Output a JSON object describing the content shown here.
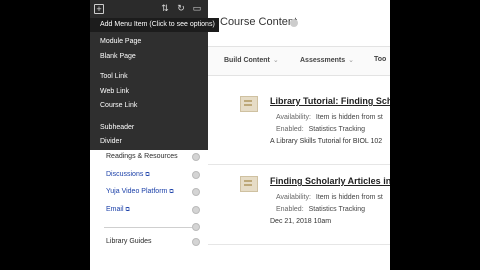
{
  "left_panel": {
    "tooltip": "Add Menu Item (Click to see options)",
    "dropdown_items": [
      "Module Page",
      "Blank Page",
      "Tool Link",
      "Web Link",
      "Course Link",
      "Subheader",
      "Divider"
    ],
    "menu_items": [
      {
        "label": "Readings & Resources",
        "ext": ""
      },
      {
        "label": "Discussions",
        "ext": "⧉"
      },
      {
        "label": "Yuja Video Platform",
        "ext": "⧉"
      },
      {
        "label": "Email",
        "ext": "⧉"
      },
      {
        "label": "Library Guides",
        "ext": ""
      }
    ]
  },
  "content": {
    "page_title": "Course Content",
    "actions": [
      "Build Content",
      "Assessments",
      "Too"
    ],
    "items": [
      {
        "title": "Library Tutorial: Finding Scho",
        "availability_label": "Availability:",
        "availability_value": "Item is hidden from st",
        "enabled_label": "Enabled:",
        "enabled_value": "Statistics Tracking",
        "description": "A Library Skills Tutorial for BIOL 102"
      },
      {
        "title": "Finding Scholarly Articles in",
        "availability_label": "Availability:",
        "availability_value": "Item is hidden from st",
        "enabled_label": "Enabled:",
        "enabled_value": "Statistics Tracking",
        "description": "Dec 21, 2018 10am"
      }
    ]
  }
}
